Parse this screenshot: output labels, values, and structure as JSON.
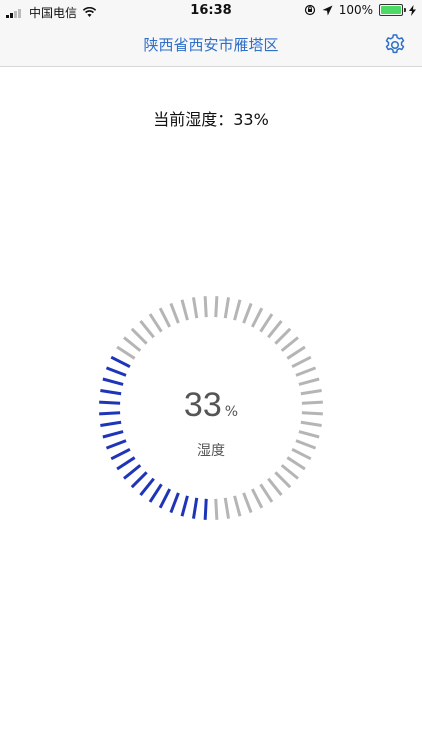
{
  "status_bar": {
    "carrier": "中国电信",
    "time": "16:38",
    "battery_percent": "100%",
    "battery_level": 1.0
  },
  "nav": {
    "title": "陕西省西安市雁塔区",
    "settings_icon": "gear-icon",
    "accent_color": "#2f6fc9"
  },
  "humidity": {
    "current_label": "当前湿度：",
    "current_value": "33%",
    "value": 33,
    "gauge_number": "33",
    "gauge_unit": "%",
    "gauge_label": "湿度",
    "active_color": "#1e35b8",
    "inactive_color": "#b5b5b5"
  }
}
